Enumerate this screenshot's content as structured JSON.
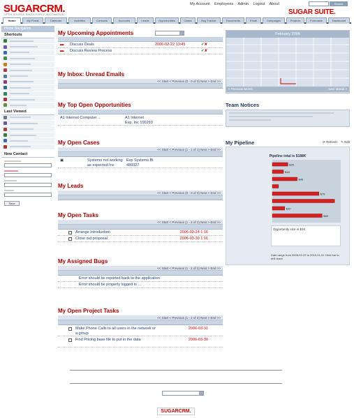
{
  "app": {
    "logo": "SUGARCRM.",
    "tagline": "OPEN SOURCE SALES FORCE AUTOMATION",
    "suite": "SUGAR SUITE.",
    "top_links": [
      "My Account",
      "Employees",
      "Admin",
      "Logout",
      "About"
    ],
    "search_label": "Search"
  },
  "tabs": [
    "Home",
    "My Portal",
    "Calendar",
    "Activities",
    "Contacts",
    "Accounts",
    "Leads",
    "Opportunities",
    "Cases",
    "Bug Tracker",
    "Documents",
    "Email",
    "Campaigns",
    "Projects",
    "Forecasts",
    "Dashboard"
  ],
  "sidebar": {
    "header": "Home Navigation",
    "shortcuts_title": "Shortcuts",
    "last_viewed_title": "Last Viewed",
    "new_contact_title": "New Contact",
    "save_label": "Save"
  },
  "colors": {
    "accent": "#cc0000",
    "nav": "#3f5b7e",
    "tab": "#c9d5e3"
  },
  "appointments": {
    "title": "My Upcoming Appointments",
    "rows": [
      {
        "subject": "Discuss Deals",
        "date": "2006-02-22 13:45"
      },
      {
        "subject": "Discuss Review Process",
        "date": ""
      }
    ]
  },
  "inbox": {
    "title": "My Inbox: Unread Emails",
    "pager": "<< Start < Previous (0 - 0 of 0) Next > End >>"
  },
  "opportunities": {
    "title": "My Top Open Opportunities",
    "rows": [
      {
        "name": "A1 Internet Computer ...",
        "account": "A1 Internet",
        "account2": "Exp. Inc 100293"
      }
    ]
  },
  "cases": {
    "title": "My Open Cases",
    "pager": "<< Start < Previous (1 - 1 of 1) Next > End >>",
    "rows": [
      {
        "subject": "Systems not working as expected Inc",
        "account": "Exp Systems Bl 489327"
      }
    ]
  },
  "leads": {
    "title": "My Leads",
    "pager": "<< Start < Previous (0 - 0 of 0) Next > End >>"
  },
  "tasks": {
    "title": "My Open Tasks",
    "pager": "<< Start < Previous (1 - 2 of 2) Next > End >>",
    "rows": [
      {
        "subject": "Arrange Introduction",
        "date": "2006-03-24 1:16"
      },
      {
        "subject": "Close out proposal",
        "date": "2006-03-30 1:16"
      }
    ]
  },
  "bugs": {
    "title": "My Assigned Bugs",
    "pager": "<< Start < Previous (1 - 2 of 2) Next > End >>",
    "rows": [
      {
        "subject": "Error should be reported back to the application"
      },
      {
        "subject": "Error should be properly logged in ..."
      }
    ]
  },
  "projects": {
    "title": "My Open Project Tasks",
    "pager": "<< Start < Previous (1 - 2 of 2) Next > End >>",
    "rows": [
      {
        "subject": "Make Phone Calls to all users in the network or a group",
        "date": "2006-03-31"
      },
      {
        "subject": "Find Pricing base file to put in the data",
        "date": "2006-03-30"
      }
    ]
  },
  "right": {
    "calendar_title": "February 2006",
    "calendar_prev": "« Previous Month",
    "calendar_next": "Next Month »",
    "notices_title": "Team Notices",
    "pipeline_title": "My Pipeline",
    "pipeline_refresh": "Refresh",
    "pipeline_edit": "Edit",
    "pipeline_total": "Pipeline total is $188K",
    "pipeline_note": "Opportunity size in $1K",
    "pipeline_footer": "Date range from 2006-02-22 to 2010-01-01 Click bar to drill down",
    "ellipse": "..."
  },
  "chart_data": {
    "type": "bar",
    "orientation": "horizontal",
    "title": "Pipeline total is $188K",
    "categories": [
      "Prospecting",
      "Qualification",
      "Needs Analysis",
      "Value Proposition",
      "Id. Decision Makers",
      "Perception Analysis",
      "Proposal/Price Quote",
      "Negotiation/Review"
    ],
    "values": [
      25,
      18,
      40,
      10,
      75,
      100,
      20,
      80
    ],
    "data_labels": [
      "$25",
      "$18",
      "$40",
      "",
      "$75",
      "",
      "$20",
      "$80"
    ],
    "xlim": [
      0,
      110
    ]
  }
}
